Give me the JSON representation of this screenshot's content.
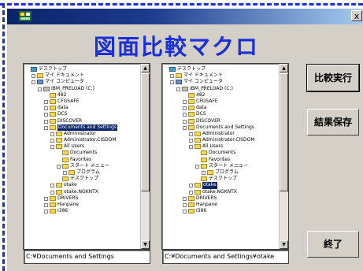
{
  "window": {
    "title": "",
    "close_glyph": "x"
  },
  "heading": "図面比較マクロ",
  "buttons": {
    "compare": "比較実行",
    "save": "結果保存",
    "exit": "終了"
  },
  "left_tree": {
    "rows": [
      {
        "label": "デスクトップ",
        "indent": 0,
        "icon": "desk",
        "exp": false
      },
      {
        "label": "マイ ドキュメント",
        "indent": 1,
        "icon": "folder",
        "exp": true
      },
      {
        "label": "マイ コンピュータ",
        "indent": 1,
        "icon": "pc",
        "exp": true
      },
      {
        "label": "IBM_PRELOAD (C:)",
        "indent": 2,
        "icon": "drive",
        "exp": true
      },
      {
        "label": "482",
        "indent": 3,
        "icon": "folder",
        "exp": false
      },
      {
        "label": "CFGSAFE",
        "indent": 3,
        "icon": "folder",
        "exp": true
      },
      {
        "label": "data",
        "indent": 3,
        "icon": "folder",
        "exp": true
      },
      {
        "label": "DCS",
        "indent": 3,
        "icon": "folder",
        "exp": true
      },
      {
        "label": "DISCOVER",
        "indent": 3,
        "icon": "folder",
        "exp": true
      },
      {
        "label": "Documents and Settings",
        "indent": 3,
        "icon": "folder",
        "exp": true,
        "selected": true
      },
      {
        "label": "Administrator",
        "indent": 4,
        "icon": "folder",
        "exp": true
      },
      {
        "label": "Administrator.CISDOM",
        "indent": 4,
        "icon": "folder",
        "exp": true
      },
      {
        "label": "All Users",
        "indent": 4,
        "icon": "folder",
        "exp": true
      },
      {
        "label": "Documents",
        "indent": 5,
        "icon": "folder",
        "exp": false
      },
      {
        "label": "Favorites",
        "indent": 5,
        "icon": "folder",
        "exp": false
      },
      {
        "label": "スタート メニュー",
        "indent": 5,
        "icon": "folder",
        "exp": true
      },
      {
        "label": "プログラム",
        "indent": 6,
        "icon": "folder",
        "exp": true
      },
      {
        "label": "デスクトップ",
        "indent": 5,
        "icon": "folder",
        "exp": false
      },
      {
        "label": "otake",
        "indent": 4,
        "icon": "folder",
        "exp": true
      },
      {
        "label": "otake.NGKNTX",
        "indent": 4,
        "icon": "folder",
        "exp": true
      },
      {
        "label": "DRIVERS",
        "indent": 3,
        "icon": "folder",
        "exp": true
      },
      {
        "label": "Hanpane",
        "indent": 3,
        "icon": "folder",
        "exp": true
      },
      {
        "label": "I386",
        "indent": 3,
        "icon": "folder",
        "exp": true
      }
    ],
    "path": "C:¥Documents and Settings"
  },
  "right_tree": {
    "rows": [
      {
        "label": "デスクトップ",
        "indent": 0,
        "icon": "desk",
        "exp": false
      },
      {
        "label": "マイ ドキュメント",
        "indent": 1,
        "icon": "folder",
        "exp": true
      },
      {
        "label": "マイ コンピュータ",
        "indent": 1,
        "icon": "pc",
        "exp": true
      },
      {
        "label": "IBM_PRELOAD (C:)",
        "indent": 2,
        "icon": "drive",
        "exp": true
      },
      {
        "label": "482",
        "indent": 3,
        "icon": "folder",
        "exp": false
      },
      {
        "label": "CFGSAFE",
        "indent": 3,
        "icon": "folder",
        "exp": true
      },
      {
        "label": "data",
        "indent": 3,
        "icon": "folder",
        "exp": true
      },
      {
        "label": "DCS",
        "indent": 3,
        "icon": "folder",
        "exp": true
      },
      {
        "label": "DISCOVER",
        "indent": 3,
        "icon": "folder",
        "exp": true
      },
      {
        "label": "Documents and Settings",
        "indent": 3,
        "icon": "folder",
        "exp": true
      },
      {
        "label": "Administrator",
        "indent": 4,
        "icon": "folder",
        "exp": true
      },
      {
        "label": "Administrator.CISDOM",
        "indent": 4,
        "icon": "folder",
        "exp": true
      },
      {
        "label": "All Users",
        "indent": 4,
        "icon": "folder",
        "exp": true
      },
      {
        "label": "Documents",
        "indent": 5,
        "icon": "folder",
        "exp": false
      },
      {
        "label": "Favorites",
        "indent": 5,
        "icon": "folder",
        "exp": false
      },
      {
        "label": "スタート メニュー",
        "indent": 5,
        "icon": "folder",
        "exp": true
      },
      {
        "label": "プログラム",
        "indent": 6,
        "icon": "folder",
        "exp": true
      },
      {
        "label": "デスクトップ",
        "indent": 5,
        "icon": "folder",
        "exp": false
      },
      {
        "label": "otake",
        "indent": 4,
        "icon": "folder",
        "exp": true,
        "selected": true
      },
      {
        "label": "otake.NGKNTX",
        "indent": 4,
        "icon": "folder",
        "exp": true
      },
      {
        "label": "DRIVERS",
        "indent": 3,
        "icon": "folder",
        "exp": true
      },
      {
        "label": "Hanpane",
        "indent": 3,
        "icon": "folder",
        "exp": true
      },
      {
        "label": "I386",
        "indent": 3,
        "icon": "folder",
        "exp": true
      }
    ],
    "path": "C:¥Documents and Settings¥otake"
  },
  "colors": {
    "accent": "#1a2fd8",
    "selection": "#0a246a",
    "face": "#d4d0c8"
  }
}
